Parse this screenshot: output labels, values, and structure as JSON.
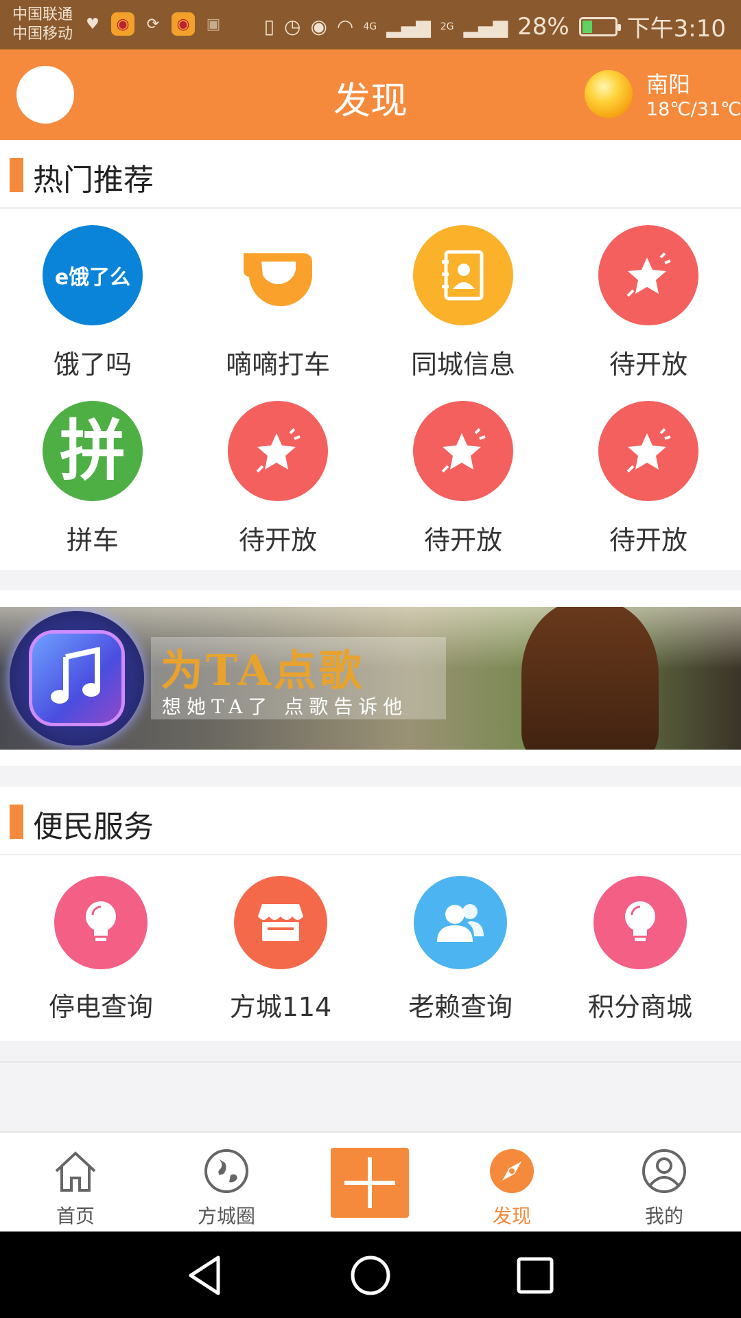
{
  "status_bar": {
    "carrier1": "中国联通",
    "carrier2": "中国移动",
    "network_4g": "4G",
    "network_2g": "2G",
    "battery": "28%",
    "time": "下午3:10"
  },
  "header": {
    "title": "发现",
    "weather": {
      "city": "南阳",
      "temp": "18℃/31℃"
    }
  },
  "hot": {
    "title": "热门推荐",
    "items": [
      {
        "label": "饿了吗",
        "icon": "eleme-icon",
        "logo_text": "e饿了么",
        "color": "#0a84d8"
      },
      {
        "label": "嘀嘀打车",
        "icon": "didi-icon",
        "color": "#ffffff"
      },
      {
        "label": "同城信息",
        "icon": "contacts-book-icon",
        "color": "#fbb12a"
      },
      {
        "label": "待开放",
        "icon": "star-icon",
        "color": "#f4605e"
      },
      {
        "label": "拼车",
        "icon": "carpool-icon",
        "logo_text": "拼",
        "color": "#4eaf45"
      },
      {
        "label": "待开放",
        "icon": "star-icon",
        "color": "#f4605e"
      },
      {
        "label": "待开放",
        "icon": "star-icon",
        "color": "#f4605e"
      },
      {
        "label": "待开放",
        "icon": "star-icon",
        "color": "#f4605e"
      }
    ]
  },
  "banner": {
    "title": "为TA点歌",
    "subtitle": "想她TA了  点歌告诉他"
  },
  "services": {
    "title": "便民服务",
    "items": [
      {
        "label": "停电查询",
        "icon": "lightbulb-icon",
        "color": "#f45f85"
      },
      {
        "label": "方城114",
        "icon": "shop-icon",
        "color": "#f5694b"
      },
      {
        "label": "老赖查询",
        "icon": "users-icon",
        "color": "#4cb4f0"
      },
      {
        "label": "积分商城",
        "icon": "lightbulb-icon",
        "color": "#f45f85"
      }
    ]
  },
  "bottom_nav": {
    "items": [
      {
        "label": "首页",
        "icon": "home-icon"
      },
      {
        "label": "方城圈",
        "icon": "globe-icon"
      },
      {
        "label": "",
        "icon": "plus-icon"
      },
      {
        "label": "发现",
        "icon": "compass-icon",
        "active": true
      },
      {
        "label": "我的",
        "icon": "profile-icon"
      }
    ]
  },
  "colors": {
    "accent": "#f58a3c",
    "status_bar": "#8a5a2e"
  }
}
